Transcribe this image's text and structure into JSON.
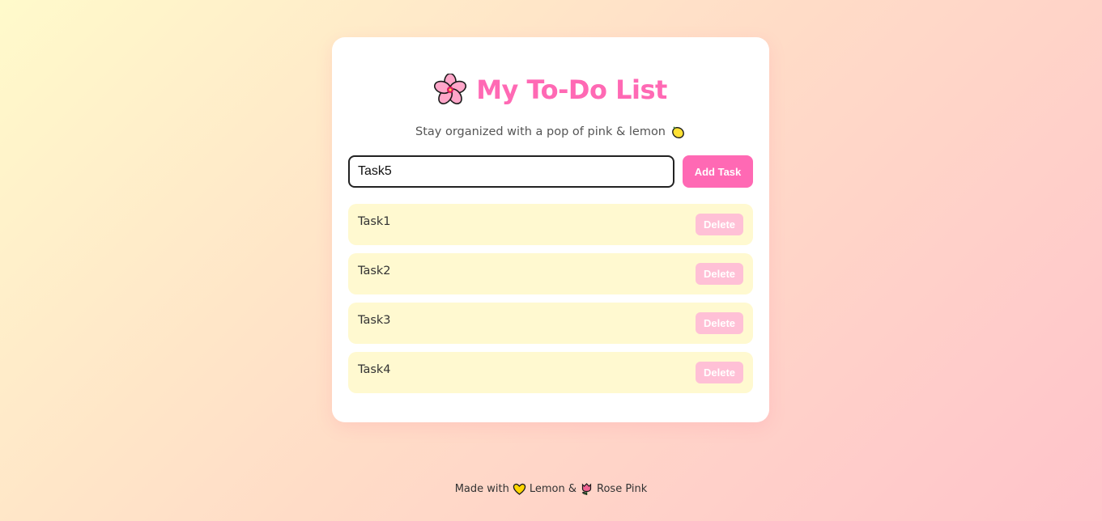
{
  "app": {
    "title": "My To-Do List",
    "subtitle": "Stay organized with a pop of pink & lemon",
    "title_icon": "cherry-blossom-icon",
    "subtitle_icon": "lemon-icon"
  },
  "input": {
    "value": "Task5",
    "placeholder": ""
  },
  "add_button": {
    "label": "Add Task"
  },
  "tasks": [
    {
      "text": "Task1",
      "delete_label": "Delete"
    },
    {
      "text": "Task2",
      "delete_label": "Delete"
    },
    {
      "text": "Task3",
      "delete_label": "Delete"
    },
    {
      "text": "Task4",
      "delete_label": "Delete"
    }
  ],
  "footer": {
    "made_with": "Made with",
    "lemon": "Lemon &",
    "rose": "Rose Pink",
    "heart_icon": "yellow-heart-icon",
    "tulip_icon": "tulip-icon"
  },
  "colors": {
    "accent_pink": "#ff69b4",
    "delete_pink": "#ffc0d6",
    "task_bg": "#fff9d0",
    "bg_lemon": "#fffacb",
    "bg_rose": "#ffc3cb"
  }
}
